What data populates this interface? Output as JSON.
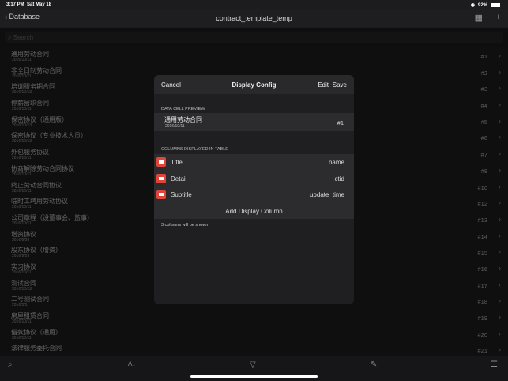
{
  "status": {
    "time": "3:17 PM",
    "date": "Sat May 18",
    "battery": "92%"
  },
  "nav": {
    "back": "Database",
    "title": "contract_template_temp"
  },
  "search": {
    "placeholder": "Search"
  },
  "rows": [
    {
      "t": "通用劳动合同",
      "s": "2016/10/11",
      "n": "#1"
    },
    {
      "t": "非全日制劳动合同",
      "s": "2016/10/11",
      "n": "#2"
    },
    {
      "t": "培训服务期合同",
      "s": "2016/10/13",
      "n": "#3"
    },
    {
      "t": "停薪留职合同",
      "s": "2016/10/11",
      "n": "#4"
    },
    {
      "t": "保密协议（通用版）",
      "s": "2016/10/13",
      "n": "#5"
    },
    {
      "t": "保密协议（专业技术人员）",
      "s": "2016/10/13",
      "n": "#6"
    },
    {
      "t": "外包服务协议",
      "s": "2016/10/11",
      "n": "#7"
    },
    {
      "t": "协商解除劳动合同协议",
      "s": "2016/10/11",
      "n": "#8"
    },
    {
      "t": "终止劳动合同协议",
      "s": "2016/10/11",
      "n": "#10"
    },
    {
      "t": "临时工聘用劳动协议",
      "s": "2016/10/11",
      "n": "#12"
    },
    {
      "t": "公司章程（设董事会、监事）",
      "s": "2016/10/11",
      "n": "#13"
    },
    {
      "t": "增资协议",
      "s": "2016/9/29",
      "n": "#14"
    },
    {
      "t": "股东协议（增资）",
      "s": "2016/9/29",
      "n": "#15"
    },
    {
      "t": "实习协议",
      "s": "2016/10/11",
      "n": "#16"
    },
    {
      "t": "测试合同",
      "s": "2016/10/13",
      "n": "#17"
    },
    {
      "t": "二号测试合同",
      "s": "2016/3/5",
      "n": "#18"
    },
    {
      "t": "房屋租赁合同",
      "s": "2016/10/11",
      "n": "#19"
    },
    {
      "t": "借款协议（通用）",
      "s": "2016/10/11",
      "n": "#20"
    },
    {
      "t": "法律服务委托合同",
      "s": "",
      "n": "#21"
    }
  ],
  "modal": {
    "cancel": "Cancel",
    "title": "Display Config",
    "edit": "Edit",
    "save": "Save",
    "preview_label": "DATA CELL PREVIEW",
    "preview": {
      "t": "通用劳动合同",
      "s": "2016/10/11",
      "n": "#1"
    },
    "columns_label": "COLUMNS DISPLAYED IN TABLE",
    "columns": [
      {
        "label": "Title",
        "field": "name"
      },
      {
        "label": "Detail",
        "field": "ctid"
      },
      {
        "label": "Subtitle",
        "field": "update_time"
      }
    ],
    "add": "Add Display Column",
    "footer": "3 columns will be shown"
  }
}
